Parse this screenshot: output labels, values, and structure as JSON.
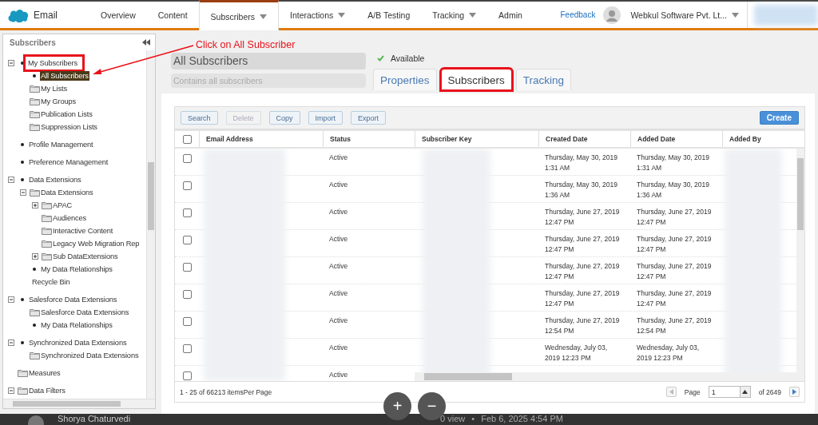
{
  "nav": {
    "app_name": "Email",
    "tabs": [
      {
        "label": "Overview",
        "selected": false,
        "has_menu": false
      },
      {
        "label": "Content",
        "selected": false,
        "has_menu": false
      },
      {
        "label": "Subscribers",
        "selected": true,
        "has_menu": true
      },
      {
        "label": "Interactions",
        "selected": false,
        "has_menu": true
      },
      {
        "label": "A/B Testing",
        "selected": false,
        "has_menu": false
      },
      {
        "label": "Tracking",
        "selected": false,
        "has_menu": true
      },
      {
        "label": "Admin",
        "selected": false,
        "has_menu": false
      }
    ],
    "feedback": "Feedback",
    "account": "Webkul Software Pvt. Lt..."
  },
  "sidebar": {
    "title": "Subscribers",
    "items": [
      {
        "label": "My Subscribers",
        "kind": "bullet",
        "expanded": true,
        "selected": false,
        "annotated": true,
        "children": [
          {
            "label": "All Subscribers",
            "kind": "bullet",
            "selected": true
          },
          {
            "label": "My Lists",
            "kind": "folder",
            "selected": false
          },
          {
            "label": "My Groups",
            "kind": "folder",
            "selected": false
          },
          {
            "label": "Publication Lists",
            "kind": "folder",
            "selected": false
          },
          {
            "label": "Suppression Lists",
            "kind": "folder",
            "selected": false
          }
        ]
      },
      {
        "label": "Profile Management",
        "kind": "bullet",
        "selected": false
      },
      {
        "label": "Preference Management",
        "kind": "bullet",
        "selected": false
      },
      {
        "label": "Data Extensions",
        "kind": "bullet",
        "expanded": true,
        "selected": false,
        "children": [
          {
            "label": "Data Extensions",
            "kind": "folder",
            "expanded": true,
            "selected": false,
            "children": [
              {
                "label": "APAC",
                "kind": "folder",
                "expanded": false,
                "selected": false
              },
              {
                "label": "Audiences",
                "kind": "folder",
                "selected": false
              },
              {
                "label": "Interactive Content",
                "kind": "folder",
                "selected": false
              },
              {
                "label": "Legacy Web Migration Rep",
                "kind": "folder",
                "selected": false
              },
              {
                "label": "Sub DataExtensions",
                "kind": "folder",
                "expanded": false,
                "selected": false
              }
            ]
          },
          {
            "label": "My Data Relationships",
            "kind": "bullet",
            "selected": false
          },
          {
            "label": "Recycle Bin",
            "kind": "plain",
            "selected": false
          }
        ]
      },
      {
        "label": "Salesforce Data Extensions",
        "kind": "bullet",
        "expanded": true,
        "selected": false,
        "children": [
          {
            "label": "Salesforce Data Extensions",
            "kind": "folder",
            "selected": false
          },
          {
            "label": "My Data Relationships",
            "kind": "bullet",
            "selected": false
          }
        ]
      },
      {
        "label": "Synchronized Data Extensions",
        "kind": "bullet",
        "expanded": true,
        "selected": false,
        "children": [
          {
            "label": "Synchronized Data Extensions",
            "kind": "folder",
            "selected": false
          }
        ]
      },
      {
        "label": "Measures",
        "kind": "folder",
        "selected": false
      },
      {
        "label": "Data Filters",
        "kind": "folder",
        "expanded": true,
        "selected": false
      }
    ]
  },
  "callout": "Click on All Subscriber",
  "header": {
    "title": "All Subscribers",
    "description_placeholder": "Contains all subscribers",
    "status": "Available",
    "tabs": [
      {
        "label": "Properties",
        "selected": false,
        "annotated": false
      },
      {
        "label": "Subscribers",
        "selected": true,
        "annotated": true
      },
      {
        "label": "Tracking",
        "selected": false,
        "annotated": false
      }
    ]
  },
  "toolbar": {
    "buttons": [
      {
        "label": "Search",
        "disabled": false
      },
      {
        "label": "Delete",
        "disabled": true
      },
      {
        "label": "Copy",
        "disabled": false
      },
      {
        "label": "Import",
        "disabled": false
      },
      {
        "label": "Export",
        "disabled": false
      }
    ],
    "create": "Create"
  },
  "table": {
    "select_all": false,
    "columns": [
      "Email Address",
      "Status",
      "Subscriber Key",
      "Created Date",
      "Added Date",
      "Added By"
    ],
    "rows": [
      {
        "checked": false,
        "status": "Active",
        "created": "Thursday, May 30, 2019\n1:31 AM",
        "added": "Thursday, May 30, 2019\n1:31 AM"
      },
      {
        "checked": false,
        "status": "Active",
        "created": "Thursday, May 30, 2019\n1:36 AM",
        "added": "Thursday, May 30, 2019\n1:36 AM"
      },
      {
        "checked": false,
        "status": "Active",
        "created": "Thursday, June 27, 2019\n12:47 PM",
        "added": "Thursday, June 27, 2019\n12:47 PM"
      },
      {
        "checked": false,
        "status": "Active",
        "created": "Thursday, June 27, 2019\n12:47 PM",
        "added": "Thursday, June 27, 2019\n12:47 PM"
      },
      {
        "checked": false,
        "status": "Active",
        "created": "Thursday, June 27, 2019\n12:47 PM",
        "added": "Thursday, June 27, 2019\n12:47 PM"
      },
      {
        "checked": false,
        "status": "Active",
        "created": "Thursday, June 27, 2019\n12:47 PM",
        "added": "Thursday, June 27, 2019\n12:47 PM"
      },
      {
        "checked": false,
        "status": "Active",
        "created": "Thursday, June 27, 2019\n12:54 PM",
        "added": "Thursday, June 27, 2019\n12:54 PM"
      },
      {
        "checked": false,
        "status": "Active",
        "created": "Wednesday, July 03,\n2019 12:23 PM",
        "added": "Wednesday, July 03,\n2019 12:23 PM"
      },
      {
        "checked": false,
        "status": "Active"
      }
    ]
  },
  "pager": {
    "summary": "1 - 25 of 66213 itemsPer Page",
    "page_label": "Page",
    "page": "1",
    "total": "of 2649"
  },
  "zoom_controls": [
    "+",
    "−"
  ],
  "footer": {
    "author": "Shorya Chaturvedi",
    "views": "0 view",
    "separator": "•",
    "date": "Feb 6, 2025 4:54 PM"
  }
}
